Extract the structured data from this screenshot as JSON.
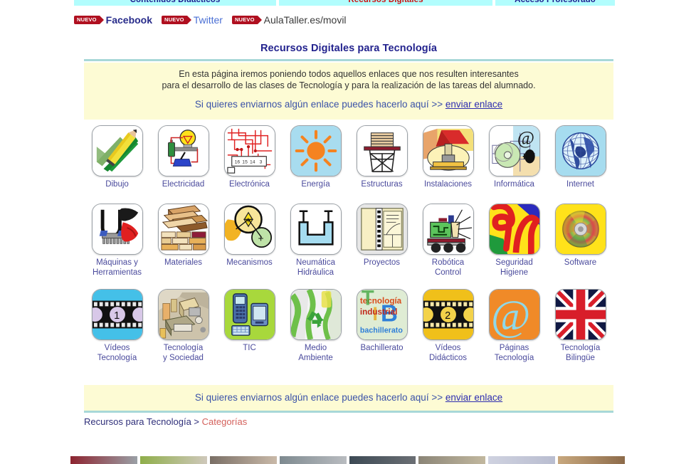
{
  "topnav": {
    "items": [
      {
        "label": "Contenidos Didácticos",
        "color": "#1b1b8f"
      },
      {
        "label": "Recursos Digitales",
        "color": "#cc1111"
      },
      {
        "label": "Acceso Profesorado",
        "color": "#1b1b8f"
      }
    ],
    "background": "#b2fdfd"
  },
  "promo": {
    "badge_label": "NUEVO",
    "badge_color": "#b01020",
    "links": [
      {
        "label": "Facebook"
      },
      {
        "label": "Twitter"
      },
      {
        "label": "AulaTaller.es/movil"
      }
    ]
  },
  "header": {
    "title": "Recursos Digitales para Tecnología"
  },
  "intro": {
    "line1": "En esta página iremos poniendo todos aquellos enlaces que nos resulten interesantes",
    "line2": "para el desarrollo de las clases de Tecnología y para la realización de las tareas del alumnado.",
    "send_prompt": "Si quieres enviarnos algún enlace puedes hacerlo aquí  >> ",
    "send_link": "enviar enlace"
  },
  "footer_panel": {
    "send_prompt": "Si quieres enviarnos algún enlace puedes hacerlo aquí  >> ",
    "send_link": "enviar enlace"
  },
  "breadcrumb": {
    "root": "Recursos para Tecnología",
    "separator": " > ",
    "current": "Categorías"
  },
  "categories": [
    {
      "icon": "drawing-icon",
      "label_line1": "Dibujo",
      "label_line2": ""
    },
    {
      "icon": "electricity-icon",
      "label_line1": "Electricidad",
      "label_line2": ""
    },
    {
      "icon": "electronics-icon",
      "label_line1": "Electrónica",
      "label_line2": ""
    },
    {
      "icon": "energy-sun-icon",
      "label_line1": "Energía",
      "label_line2": ""
    },
    {
      "icon": "structures-icon",
      "label_line1": "Estructuras",
      "label_line2": ""
    },
    {
      "icon": "installations-icon",
      "label_line1": "Instalaciones",
      "label_line2": ""
    },
    {
      "icon": "computing-icon",
      "label_line1": "Informática",
      "label_line2": ""
    },
    {
      "icon": "internet-globe-icon",
      "label_line1": "Internet",
      "label_line2": ""
    },
    {
      "icon": "tools-icon",
      "label_line1": "Máquinas y",
      "label_line2": "Herramientas"
    },
    {
      "icon": "materials-icon",
      "label_line1": "Materiales",
      "label_line2": ""
    },
    {
      "icon": "mechanisms-icon",
      "label_line1": "Mecanismos",
      "label_line2": ""
    },
    {
      "icon": "pneumatics-icon",
      "label_line1": "Neumática",
      "label_line2": "Hidráulica"
    },
    {
      "icon": "projects-icon",
      "label_line1": "Proyectos",
      "label_line2": ""
    },
    {
      "icon": "robotics-icon",
      "label_line1": "Robótica",
      "label_line2": "Control"
    },
    {
      "icon": "safety-icon",
      "label_line1": "Seguridad",
      "label_line2": "Higiene"
    },
    {
      "icon": "software-cd-icon",
      "label_line1": "Software",
      "label_line2": ""
    },
    {
      "icon": "videos-film1-icon",
      "label_line1": "Vídeos",
      "label_line2": "Tecnología"
    },
    {
      "icon": "society-icon",
      "label_line1": "Tecnología",
      "label_line2": "y Sociedad"
    },
    {
      "icon": "tic-icon",
      "label_line1": "TIC",
      "label_line2": ""
    },
    {
      "icon": "environment-icon",
      "label_line1": "Medio",
      "label_line2": "Ambiente"
    },
    {
      "icon": "bachillerato-icon",
      "label_line1": "Bachillerato",
      "label_line2": ""
    },
    {
      "icon": "videos-film2-icon",
      "label_line1": "Vídeos",
      "label_line2": "Didácticos"
    },
    {
      "icon": "at-pages-icon",
      "label_line1": "Páginas",
      "label_line2": "Tecnología"
    },
    {
      "icon": "uk-flag-icon",
      "label_line1": "Tecnología",
      "label_line2": "Bilingüe"
    }
  ],
  "bottom_strip": {
    "thumb_colors": [
      "#8d2430",
      "#9aa0a6",
      "#8fae4a",
      "#cfc8bb",
      "#7a6f66",
      "#c9b9a8",
      "#7e8a90",
      "#b9bcc0",
      "#3d4a55",
      "#6b6f74",
      "#8b8577",
      "#c2b89f",
      "#cfd2e0",
      "#b9bdd0",
      "#c8a87e",
      "#8d6b4a"
    ]
  }
}
